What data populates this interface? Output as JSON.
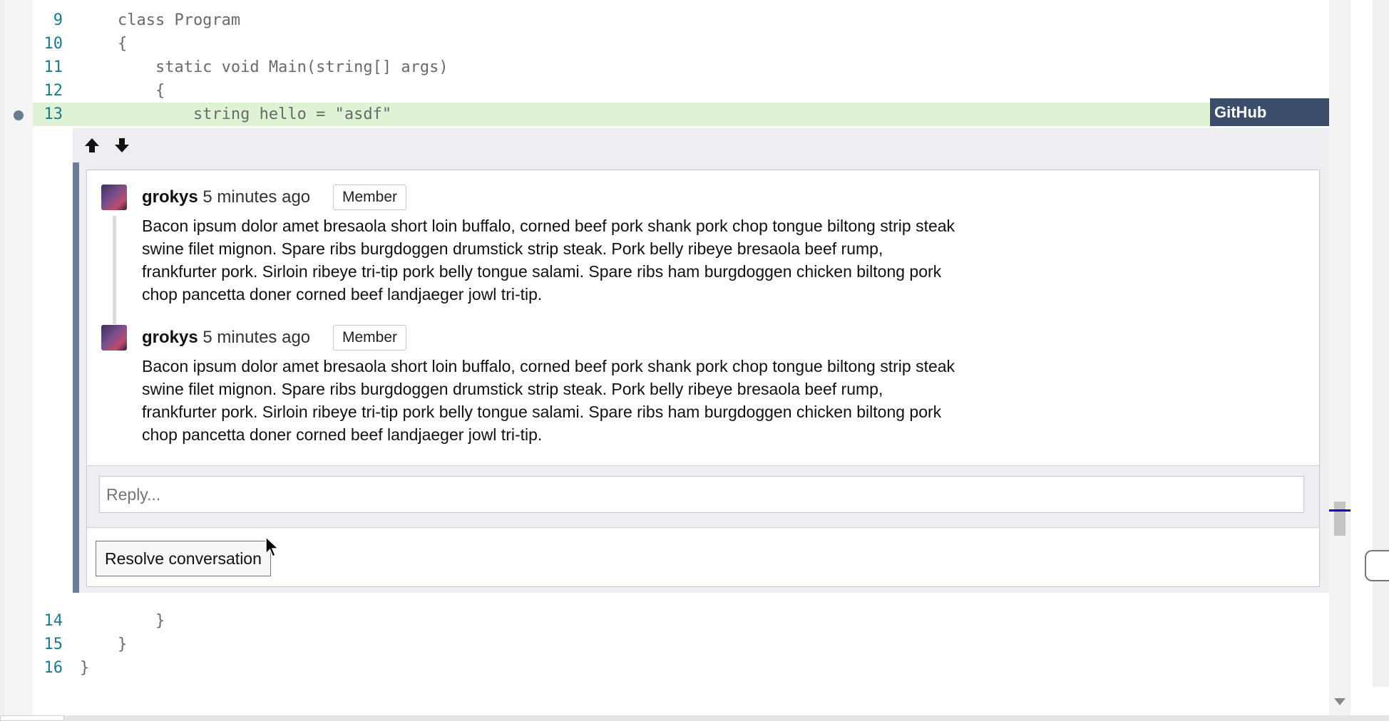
{
  "code_lines_top": [
    {
      "num": "9",
      "text": "    class Program"
    },
    {
      "num": "10",
      "text": "    {"
    },
    {
      "num": "11",
      "text": "        static void Main(string[] args)"
    },
    {
      "num": "12",
      "text": "        {"
    },
    {
      "num": "13",
      "text": "            string hello = \"asdf\""
    }
  ],
  "code_lines_bottom": [
    {
      "num": "14",
      "text": "        }"
    },
    {
      "num": "15",
      "text": "    }"
    },
    {
      "num": "16",
      "text": "}"
    }
  ],
  "github_tag": "GitHub",
  "nav": {
    "up_icon": "arrow-up-icon",
    "down_icon": "arrow-down-icon"
  },
  "comments": [
    {
      "author": "grokys",
      "time": "5 minutes ago",
      "badge": "Member",
      "body": "Bacon ipsum dolor amet bresaola short loin buffalo, corned beef pork shank pork chop tongue biltong strip steak swine filet mignon. Spare ribs burgdoggen drumstick strip steak. Pork belly ribeye bresaola beef rump, frankfurter pork. Sirloin ribeye tri-tip pork belly tongue salami. Spare ribs ham burgdoggen chicken biltong pork chop pancetta doner corned beef landjaeger jowl tri-tip."
    },
    {
      "author": "grokys",
      "time": "5 minutes ago",
      "badge": "Member",
      "body": "Bacon ipsum dolor amet bresaola short loin buffalo, corned beef pork shank pork chop tongue biltong strip steak swine filet mignon. Spare ribs burgdoggen drumstick strip steak. Pork belly ribeye bresaola beef rump, frankfurter pork. Sirloin ribeye tri-tip pork belly tongue salami. Spare ribs ham burgdoggen chicken biltong pork chop pancetta doner corned beef landjaeger jowl tri-tip."
    }
  ],
  "reply": {
    "placeholder": "Reply..."
  },
  "resolve_label": "Resolve conversation",
  "colors": {
    "active_line": "#dff3d4",
    "github_tag": "#3c4d6b",
    "line_number": "#1d7a8c",
    "thread_accent": "#6b7c94"
  }
}
